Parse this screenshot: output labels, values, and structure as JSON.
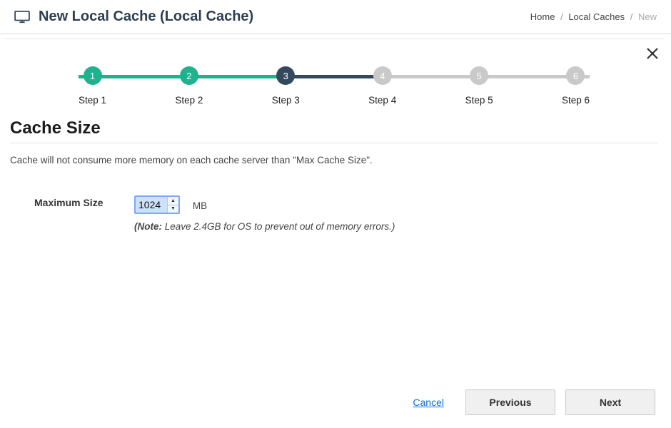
{
  "header": {
    "title": "New Local Cache (Local Cache)"
  },
  "breadcrumb": {
    "home": "Home",
    "parent": "Local Caches",
    "current": "New"
  },
  "stepper": {
    "steps": [
      {
        "num": "1",
        "label": "Step 1",
        "state": "done"
      },
      {
        "num": "2",
        "label": "Step 2",
        "state": "done"
      },
      {
        "num": "3",
        "label": "Step 3",
        "state": "active"
      },
      {
        "num": "4",
        "label": "Step 4",
        "state": "future"
      },
      {
        "num": "5",
        "label": "Step 5",
        "state": "future"
      },
      {
        "num": "6",
        "label": "Step 6",
        "state": "future"
      }
    ]
  },
  "section": {
    "title": "Cache Size",
    "description": "Cache will not consume more memory on each cache server than \"Max Cache Size\"."
  },
  "form": {
    "max_size_label": "Maximum Size",
    "max_size_value": "1024",
    "unit": "MB",
    "note_prefix": "(Note:",
    "note_text": " Leave 2.4GB for OS to prevent out of memory errors.)"
  },
  "actions": {
    "cancel": "Cancel",
    "previous": "Previous",
    "next": "Next"
  }
}
